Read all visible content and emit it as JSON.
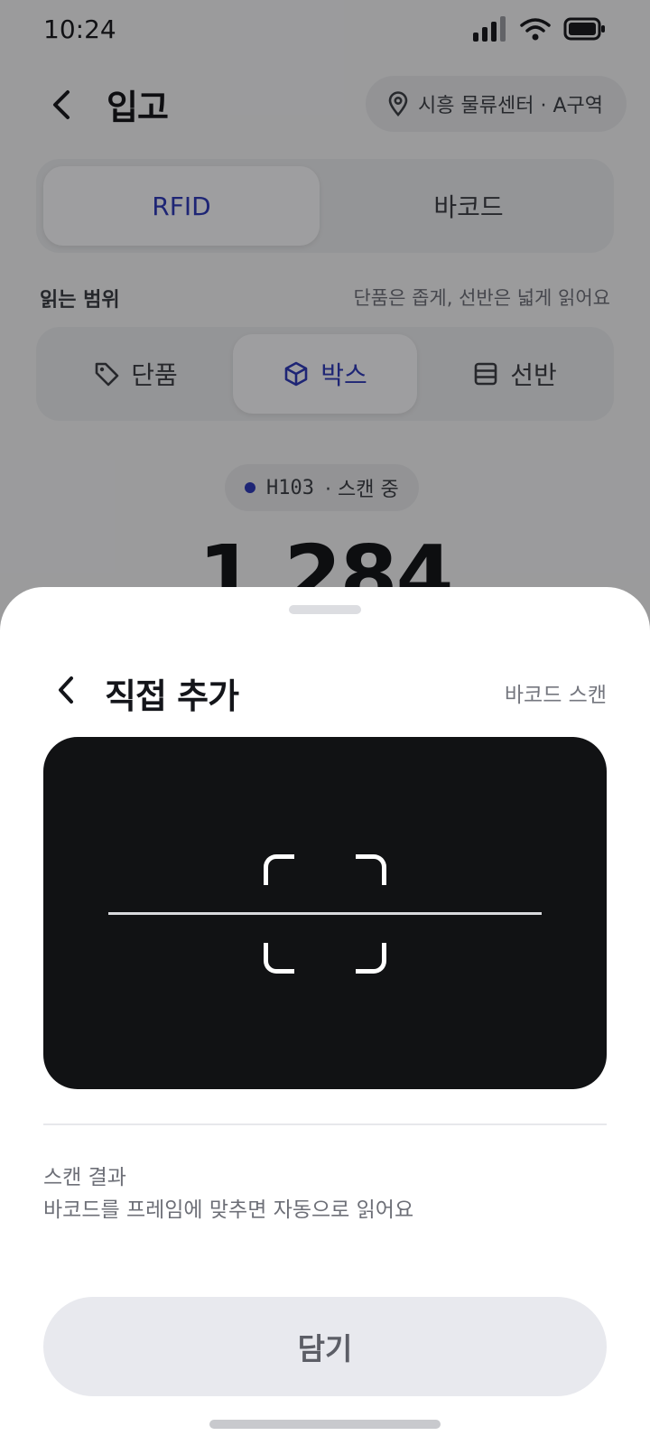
{
  "status_bar": {
    "time": "10:24"
  },
  "header": {
    "title": "입고",
    "location": "시흥 물류센터 · A구역"
  },
  "mode_tabs": [
    {
      "label": "RFID",
      "selected": true
    },
    {
      "label": "바코드",
      "selected": false
    }
  ],
  "range": {
    "label": "읽는 범위",
    "hint": "단품은 좁게, 선반은 넓게 읽어요",
    "options": [
      {
        "label": "단품",
        "icon": "tag-icon",
        "selected": false
      },
      {
        "label": "박스",
        "icon": "box-icon",
        "selected": true
      },
      {
        "label": "선반",
        "icon": "shelf-icon",
        "selected": false
      }
    ]
  },
  "scan_status": {
    "code": "H103",
    "text": "· 스캔 중"
  },
  "count": "1,284",
  "sheet": {
    "title": "직접 추가",
    "action": "바코드 스캔",
    "result_title": "스캔 결과",
    "result_hint": "바코드를 프레임에 맞추면 자동으로 읽어요",
    "button_label": "담기"
  },
  "colors": {
    "accent": "#2f3ab8",
    "camera_bg": "#111214",
    "button_disabled": "#e8e9ee"
  }
}
